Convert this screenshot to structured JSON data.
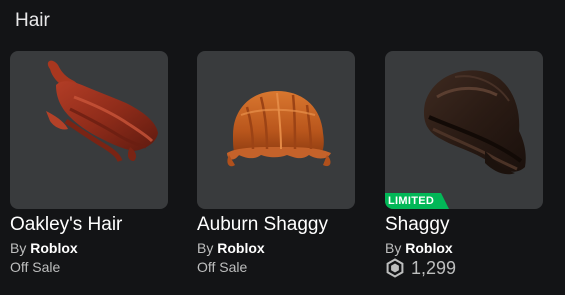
{
  "section": {
    "title": "Hair"
  },
  "items": [
    {
      "name": "Oakley's Hair",
      "by_label": "By",
      "creator": "Roblox",
      "status": "Off Sale",
      "icon": "hair-thumbnail-oakley"
    },
    {
      "name": "Auburn Shaggy",
      "by_label": "By",
      "creator": "Roblox",
      "status": "Off Sale",
      "icon": "hair-thumbnail-auburn-shaggy"
    },
    {
      "name": "Shaggy",
      "by_label": "By",
      "creator": "Roblox",
      "badge": "LIMITED",
      "price": "1,299",
      "currency_icon": "robux-icon",
      "icon": "hair-thumbnail-shaggy"
    }
  ],
  "colors": {
    "background": "#131416",
    "card_background": "#393b3d",
    "limited_badge": "#02b757",
    "secondary_text": "#bdbebe"
  }
}
